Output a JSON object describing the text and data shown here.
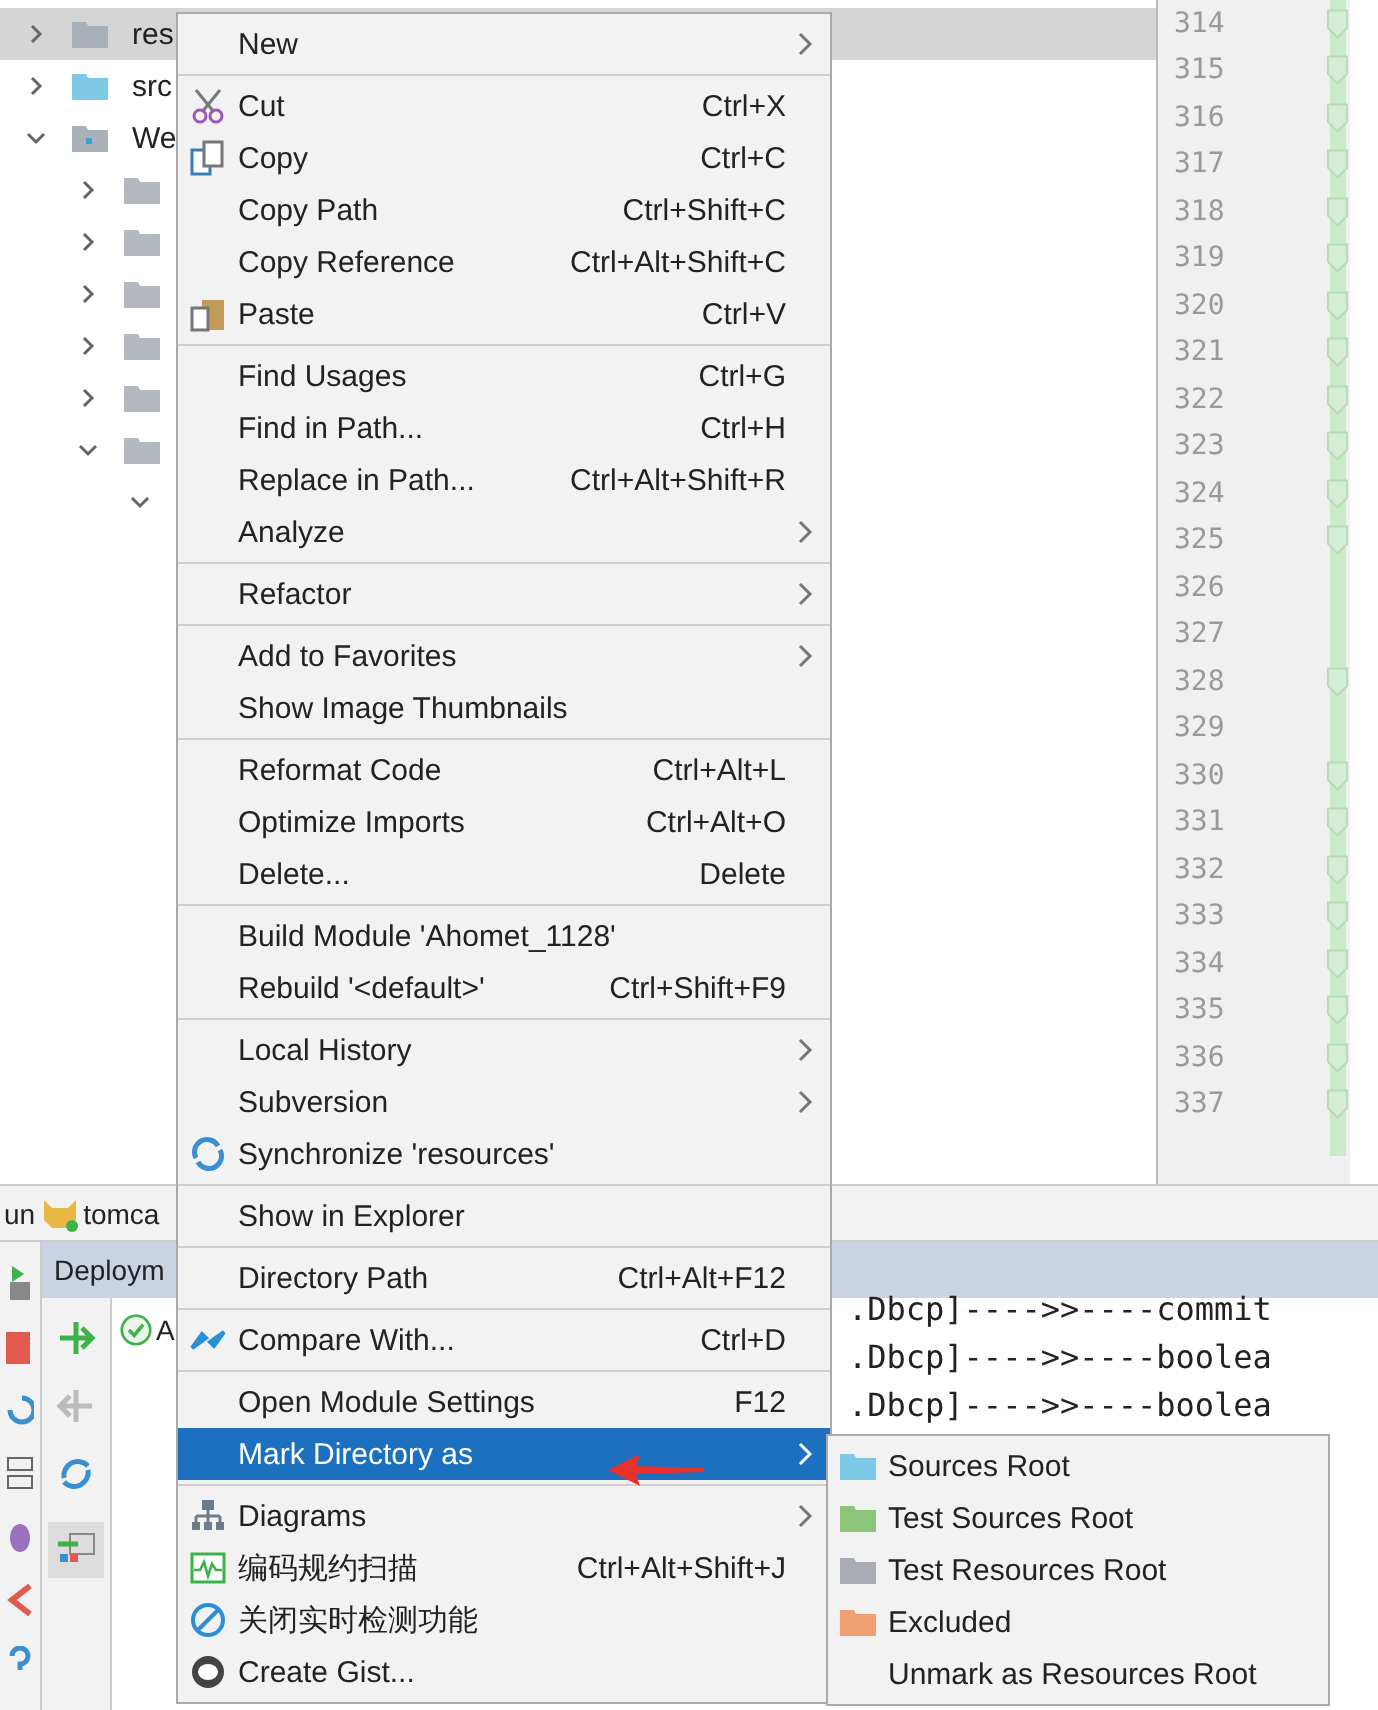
{
  "project_tree": {
    "items": [
      {
        "label": "res",
        "expanded": false,
        "selected": true,
        "kind": "resources"
      },
      {
        "label": "src",
        "expanded": false,
        "selected": false,
        "kind": "source"
      },
      {
        "label": "We",
        "expanded": true,
        "selected": false,
        "kind": "web",
        "children": [
          {
            "expanded": false,
            "selected": false,
            "kind": "folder"
          },
          {
            "expanded": false,
            "selected": false,
            "kind": "folder"
          },
          {
            "expanded": false,
            "selected": false,
            "kind": "folder"
          },
          {
            "expanded": false,
            "selected": false,
            "kind": "folder"
          },
          {
            "expanded": false,
            "selected": false,
            "kind": "folder"
          },
          {
            "expanded": true,
            "selected": false,
            "kind": "folder",
            "children": [
              {
                "expanded": true,
                "selected": false
              }
            ]
          }
        ]
      }
    ]
  },
  "gutter": {
    "line_numbers": [
      "314",
      "315",
      "316",
      "317",
      "318",
      "319",
      "320",
      "321",
      "322",
      "323",
      "324",
      "325",
      "326",
      "327",
      "328",
      "329",
      "330",
      "331",
      "332",
      "333",
      "334",
      "335",
      "336",
      "337"
    ]
  },
  "run_panel": {
    "title_prefix": "un",
    "title": "tomca",
    "tab": "Deploym",
    "deployment": "A",
    "console_lines": [
      ".Dbcp]---->>----commit",
      ".Dbcp]---->>----boolea",
      ".Dbcp]---->>----boolea"
    ]
  },
  "context_menu": {
    "groups": [
      {
        "items": [
          {
            "label": "New",
            "submenu": true,
            "selected": false
          }
        ]
      },
      {
        "items": [
          {
            "label": "Cut",
            "shortcut": "Ctrl+X",
            "submenu": false,
            "selected": false
          },
          {
            "label": "Copy",
            "shortcut": "Ctrl+C",
            "submenu": false,
            "selected": false
          },
          {
            "label": "Copy Path",
            "shortcut": "Ctrl+Shift+C",
            "submenu": false,
            "selected": false
          },
          {
            "label": "Copy Reference",
            "shortcut": "Ctrl+Alt+Shift+C",
            "submenu": false,
            "selected": false
          },
          {
            "label": "Paste",
            "shortcut": "Ctrl+V",
            "submenu": false,
            "selected": false
          }
        ]
      },
      {
        "items": [
          {
            "label": "Find Usages",
            "shortcut": "Ctrl+G",
            "submenu": false,
            "selected": false
          },
          {
            "label": "Find in Path...",
            "shortcut": "Ctrl+H",
            "submenu": false,
            "selected": false
          },
          {
            "label": "Replace in Path...",
            "shortcut": "Ctrl+Alt+Shift+R",
            "submenu": false,
            "selected": false
          },
          {
            "label": "Analyze",
            "submenu": true,
            "selected": false
          }
        ]
      },
      {
        "items": [
          {
            "label": "Refactor",
            "submenu": true,
            "selected": false
          }
        ]
      },
      {
        "items": [
          {
            "label": "Add to Favorites",
            "submenu": true,
            "selected": false
          },
          {
            "label": "Show Image Thumbnails",
            "submenu": false,
            "selected": false
          }
        ]
      },
      {
        "items": [
          {
            "label": "Reformat Code",
            "shortcut": "Ctrl+Alt+L",
            "submenu": false,
            "selected": false
          },
          {
            "label": "Optimize Imports",
            "shortcut": "Ctrl+Alt+O",
            "submenu": false,
            "selected": false
          },
          {
            "label": "Delete...",
            "shortcut": "Delete",
            "submenu": false,
            "selected": false
          }
        ]
      },
      {
        "items": [
          {
            "label": "Build Module 'Ahomet_1128'",
            "submenu": false,
            "selected": false
          },
          {
            "label": "Rebuild '<default>'",
            "shortcut": "Ctrl+Shift+F9",
            "submenu": false,
            "selected": false
          }
        ]
      },
      {
        "items": [
          {
            "label": "Local History",
            "submenu": true,
            "selected": false
          },
          {
            "label": "Subversion",
            "submenu": true,
            "selected": false
          },
          {
            "label": "Synchronize 'resources'",
            "submenu": false,
            "selected": false
          }
        ]
      },
      {
        "items": [
          {
            "label": "Show in Explorer",
            "submenu": false,
            "selected": false
          }
        ]
      },
      {
        "items": [
          {
            "label": "Directory Path",
            "shortcut": "Ctrl+Alt+F12",
            "submenu": false,
            "selected": false
          }
        ]
      },
      {
        "items": [
          {
            "label": "Compare With...",
            "shortcut": "Ctrl+D",
            "submenu": false,
            "selected": false
          }
        ]
      },
      {
        "items": [
          {
            "label": "Open Module Settings",
            "shortcut": "F12",
            "submenu": false,
            "selected": false
          },
          {
            "label": "Mark Directory as",
            "submenu": true,
            "selected": true
          }
        ]
      },
      {
        "items": [
          {
            "label": "Diagrams",
            "submenu": true,
            "selected": false
          },
          {
            "label": "编码规约扫描",
            "shortcut": "Ctrl+Alt+Shift+J",
            "submenu": false,
            "selected": false
          },
          {
            "label": "关闭实时检测功能",
            "submenu": false,
            "selected": false
          },
          {
            "label": "Create Gist...",
            "submenu": false,
            "selected": false
          }
        ]
      }
    ]
  },
  "submenu": {
    "items": [
      {
        "label": "Sources Root",
        "color": "#7ec8e8"
      },
      {
        "label": "Test Sources Root",
        "color": "#8cc57a"
      },
      {
        "label": "Test Resources Root",
        "color": "#a9adb3"
      },
      {
        "label": "Excluded",
        "color": "#f0a070"
      },
      {
        "label": "Unmark as Resources Root"
      }
    ]
  }
}
